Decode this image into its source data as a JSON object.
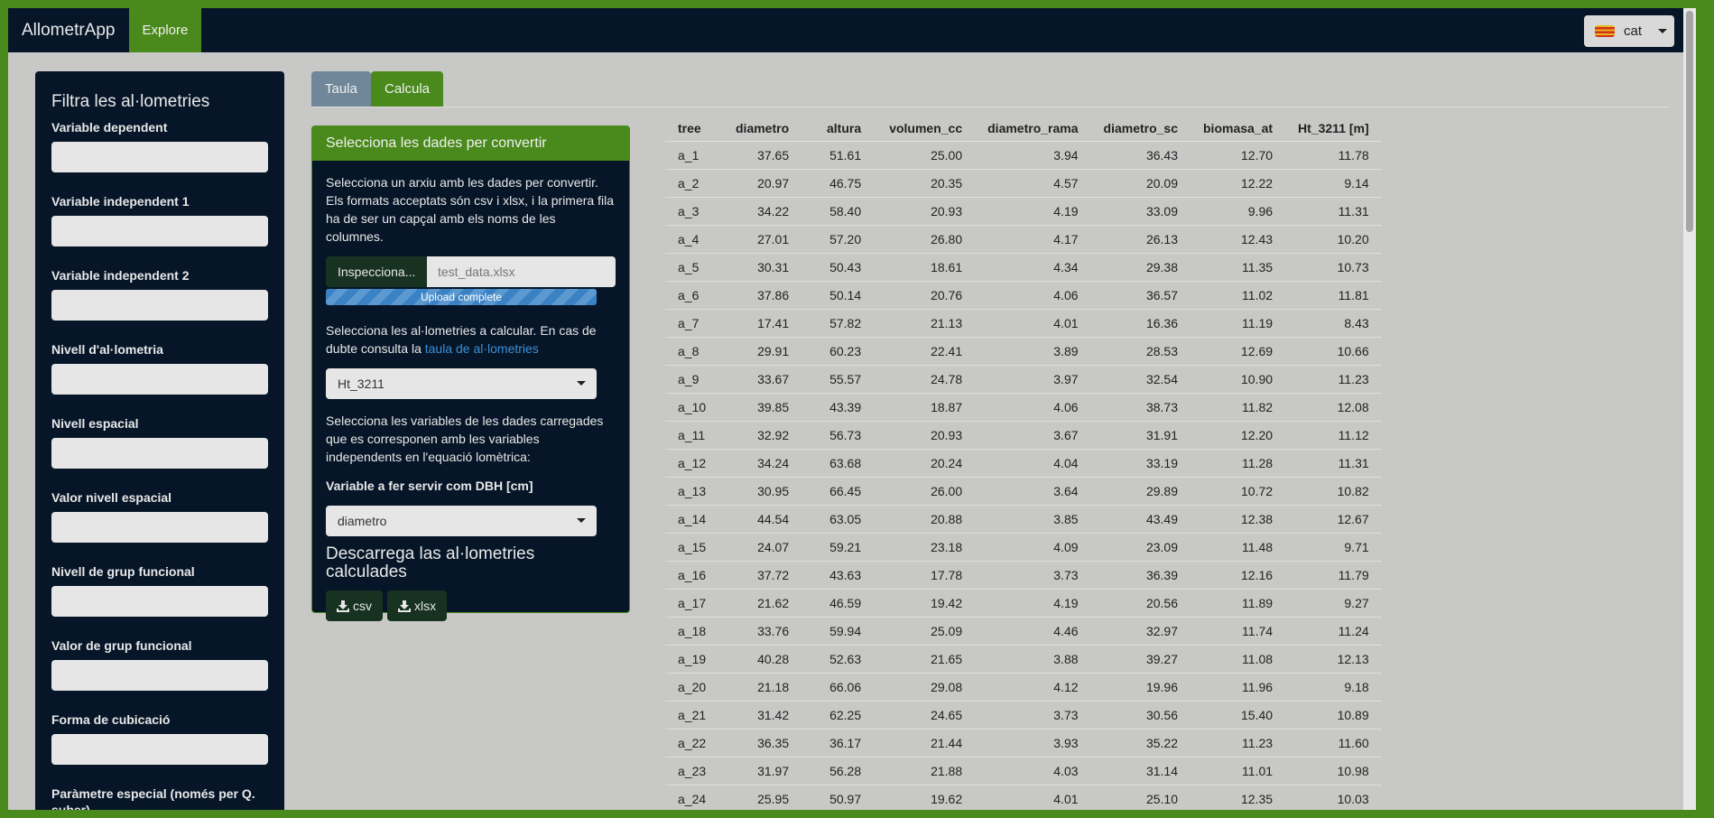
{
  "navbar": {
    "brand": "AllometrApp",
    "explore_label": "Explore",
    "language_label": "cat"
  },
  "sidebar": {
    "title": "Filtra les al·lometries",
    "fields": [
      {
        "label": "Variable dependent"
      },
      {
        "label": "Variable independent 1"
      },
      {
        "label": "Variable independent 2"
      },
      {
        "label": "Nivell d'al·lometria"
      },
      {
        "label": "Nivell espacial"
      },
      {
        "label": "Valor nivell espacial"
      },
      {
        "label": "Nivell de grup funcional"
      },
      {
        "label": "Valor de grup funcional"
      },
      {
        "label": "Forma de cubicació"
      },
      {
        "label": "Paràmetre especial (només per Q. suber)"
      }
    ]
  },
  "tabs": [
    {
      "label": "Taula",
      "active": false
    },
    {
      "label": "Calcula",
      "active": true
    }
  ],
  "panel": {
    "heading": "Selecciona les dades per convertir",
    "file_instructions": "Selecciona un arxiu amb les dades per convertir. Els formats acceptats són csv i xlsx, i la primera fila ha de ser un capçal amb els noms de les columnes.",
    "browse_label": "Inspecciona...",
    "file_name": "test_data.xlsx",
    "upload_status": "Upload complete",
    "allometry_instructions": "Selecciona les al·lometries a calcular. En cas de dubte consulta la",
    "allometry_link": "taula de al·lometries",
    "allometry_selected": "Ht_3211",
    "variables_instructions": "Selecciona les variables de les dades carregades que es corresponen amb les variables independents en l'equació lomètrica:",
    "dbh_label": "Variable a fer servir com DBH [cm]",
    "dbh_selected": "diametro",
    "download_title": "Descarrega las al·lometries calculades",
    "download_csv": "csv",
    "download_xlsx": "xlsx"
  },
  "table": {
    "columns": [
      "tree",
      "diametro",
      "altura",
      "volumen_cc",
      "diametro_rama",
      "diametro_sc",
      "biomasa_at",
      "Ht_3211 [m]"
    ],
    "rows": [
      [
        "a_1",
        "37.65",
        "51.61",
        "25.00",
        "3.94",
        "36.43",
        "12.70",
        "11.78"
      ],
      [
        "a_2",
        "20.97",
        "46.75",
        "20.35",
        "4.57",
        "20.09",
        "12.22",
        "9.14"
      ],
      [
        "a_3",
        "34.22",
        "58.40",
        "20.93",
        "4.19",
        "33.09",
        "9.96",
        "11.31"
      ],
      [
        "a_4",
        "27.01",
        "57.20",
        "26.80",
        "4.17",
        "26.13",
        "12.43",
        "10.20"
      ],
      [
        "a_5",
        "30.31",
        "50.43",
        "18.61",
        "4.34",
        "29.38",
        "11.35",
        "10.73"
      ],
      [
        "a_6",
        "37.86",
        "50.14",
        "20.76",
        "4.06",
        "36.57",
        "11.02",
        "11.81"
      ],
      [
        "a_7",
        "17.41",
        "57.82",
        "21.13",
        "4.01",
        "16.36",
        "11.19",
        "8.43"
      ],
      [
        "a_8",
        "29.91",
        "60.23",
        "22.41",
        "3.89",
        "28.53",
        "12.69",
        "10.66"
      ],
      [
        "a_9",
        "33.67",
        "55.57",
        "24.78",
        "3.97",
        "32.54",
        "10.90",
        "11.23"
      ],
      [
        "a_10",
        "39.85",
        "43.39",
        "18.87",
        "4.06",
        "38.73",
        "11.82",
        "12.08"
      ],
      [
        "a_11",
        "32.92",
        "56.73",
        "20.93",
        "3.67",
        "31.91",
        "12.20",
        "11.12"
      ],
      [
        "a_12",
        "34.24",
        "63.68",
        "20.24",
        "4.04",
        "33.19",
        "11.28",
        "11.31"
      ],
      [
        "a_13",
        "30.95",
        "66.45",
        "26.00",
        "3.64",
        "29.89",
        "10.72",
        "10.82"
      ],
      [
        "a_14",
        "44.54",
        "63.05",
        "20.88",
        "3.85",
        "43.49",
        "12.38",
        "12.67"
      ],
      [
        "a_15",
        "24.07",
        "59.21",
        "23.18",
        "4.09",
        "23.09",
        "11.48",
        "9.71"
      ],
      [
        "a_16",
        "37.72",
        "43.63",
        "17.78",
        "3.73",
        "36.39",
        "12.16",
        "11.79"
      ],
      [
        "a_17",
        "21.62",
        "46.59",
        "19.42",
        "4.19",
        "20.56",
        "11.89",
        "9.27"
      ],
      [
        "a_18",
        "33.76",
        "59.94",
        "25.09",
        "4.46",
        "32.97",
        "11.74",
        "11.24"
      ],
      [
        "a_19",
        "40.28",
        "52.63",
        "21.65",
        "3.88",
        "39.27",
        "11.08",
        "12.13"
      ],
      [
        "a_20",
        "21.18",
        "66.06",
        "29.08",
        "4.12",
        "19.96",
        "11.96",
        "9.18"
      ],
      [
        "a_21",
        "31.42",
        "62.25",
        "24.65",
        "3.73",
        "30.56",
        "15.40",
        "10.89"
      ],
      [
        "a_22",
        "36.35",
        "36.17",
        "21.44",
        "3.93",
        "35.22",
        "11.23",
        "11.60"
      ],
      [
        "a_23",
        "31.97",
        "56.28",
        "21.88",
        "4.03",
        "31.14",
        "11.01",
        "10.98"
      ],
      [
        "a_24",
        "25.95",
        "50.97",
        "19.62",
        "4.01",
        "25.10",
        "12.35",
        "10.03"
      ]
    ]
  },
  "colors": {
    "brand_green": "#4a8a1c",
    "navy": "#061628",
    "background": "#c8c9c6"
  }
}
